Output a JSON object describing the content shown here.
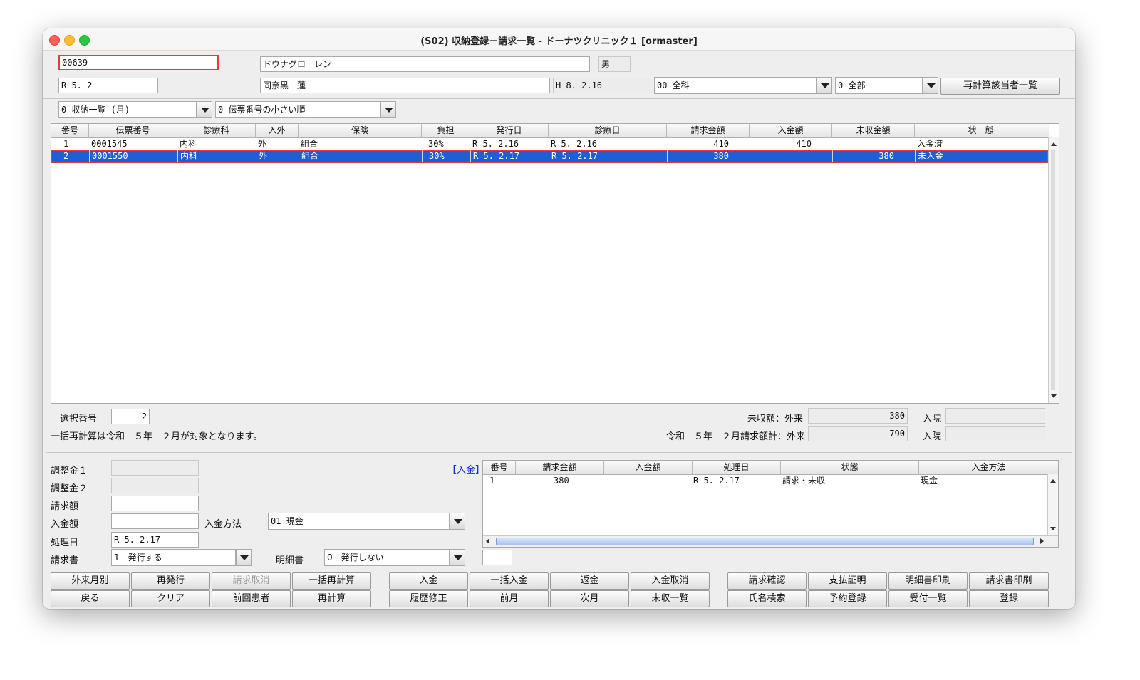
{
  "window": {
    "title": "(S02) 収納登録－請求一覧 - ドーナツクリニック１ [ormaster]"
  },
  "patient": {
    "id": "00639",
    "name": "ドウナグロ　レン",
    "sex": "男",
    "date": "R 5. 2",
    "kanji_name": "同奈黒　蓮",
    "birth": "H 8. 2.16",
    "dept": "00 全科",
    "scope": "0 全部",
    "recalc_button": "再計算該当者一覧"
  },
  "filters": {
    "list_type": "0 収納一覧 (月)",
    "sort": "0 伝票番号の小さい順"
  },
  "main_table": {
    "headers": [
      "番号",
      "伝票番号",
      "診療科",
      "入外",
      "保険",
      "負担",
      "発行日",
      "診療日",
      "請求金額",
      "入金額",
      "未収金額",
      "状　態"
    ],
    "rows": [
      [
        "1",
        "0001545",
        "内科",
        "外",
        "組合",
        "30%",
        "R 5. 2.16",
        "R 5. 2.16",
        "410",
        "410",
        "",
        "入金済"
      ],
      [
        "2",
        "0001550",
        "内科",
        "外",
        "組合",
        "30%",
        "R 5. 2.17",
        "R 5. 2.17",
        "380",
        "",
        "380",
        "未入金"
      ]
    ],
    "selected_row": 2
  },
  "selection": {
    "label": "選択番号",
    "value": "2",
    "note": "一括再計算は令和　５年　２月が対象となります。"
  },
  "summary": {
    "unpaid_label": "未収額：外来",
    "unpaid_value": "380",
    "inpatient_label": "入院",
    "month_label": "令和　５年　２月請求額計：外来",
    "month_value": "790",
    "inpatient_label2": "入院"
  },
  "form": {
    "adjust1_label": "調整金１",
    "adjust2_label": "調整金２",
    "bill_label": "請求額",
    "payment_label": "入金額",
    "method_label": "入金方法",
    "method_value": "01 現金",
    "date_label": "処理日",
    "date_value": "R 5. 2.17",
    "invoice_label": "請求書",
    "invoice_value": "1　発行する",
    "detail_label": "明細書",
    "detail_value": "0　発行しない",
    "payment_tag": "【入金】"
  },
  "payment_table": {
    "headers": [
      "番号",
      "請求金額",
      "入金額",
      "処理日",
      "状態",
      "入金方法"
    ],
    "rows": [
      [
        "1",
        "380",
        "",
        "R 5. 2.17",
        "請求・未収",
        "現金"
      ]
    ]
  },
  "buttons": {
    "row1": [
      "外来月別",
      "再発行",
      "請求取消",
      "一括再計算",
      "入金",
      "一括入金",
      "返金",
      "入金取消",
      "請求確認",
      "支払証明",
      "明細書印刷",
      "請求書印刷"
    ],
    "row2": [
      "戻る",
      "クリア",
      "前回患者",
      "再計算",
      "履歴修正",
      "前月",
      "次月",
      "未収一覧",
      "氏名検索",
      "予約登録",
      "受付一覧",
      "登録"
    ]
  }
}
